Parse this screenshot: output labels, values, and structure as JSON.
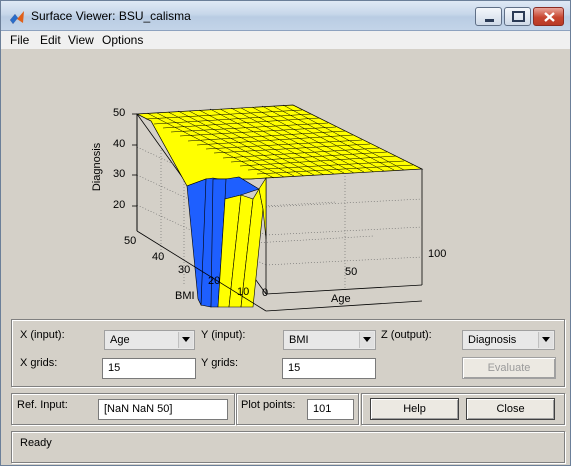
{
  "window": {
    "title": "Surface Viewer: BSU_calisma",
    "icon": "matlab-logo-icon"
  },
  "menu": [
    "File",
    "Edit",
    "View",
    "Options"
  ],
  "plot": {
    "zlabel": "Diagnosis",
    "ylabel": "BMI",
    "xlabel": "Age",
    "z_ticks": [
      "20",
      "30",
      "40",
      "50"
    ],
    "y_ticks": [
      "10",
      "20",
      "30",
      "40",
      "50"
    ],
    "x_ticks": [
      "0",
      "50",
      "100"
    ],
    "colors": {
      "yellow": "#ffff00",
      "blue": "#1e5fff",
      "grid": "#000000"
    }
  },
  "controls": {
    "x_input_label": "X (input):",
    "x_input_value": "Age",
    "y_input_label": "Y (input):",
    "y_input_value": "BMI",
    "z_output_label": "Z (output):",
    "z_output_value": "Diagnosis",
    "x_grids_label": "X grids:",
    "x_grids_value": "15",
    "y_grids_label": "Y grids:",
    "y_grids_value": "15",
    "evaluate_label": "Evaluate",
    "ref_input_label": "Ref. Input:",
    "ref_input_value": "[NaN NaN 50]",
    "plot_points_label": "Plot points:",
    "plot_points_value": "101",
    "help_label": "Help",
    "close_label": "Close"
  },
  "status": "Ready"
}
